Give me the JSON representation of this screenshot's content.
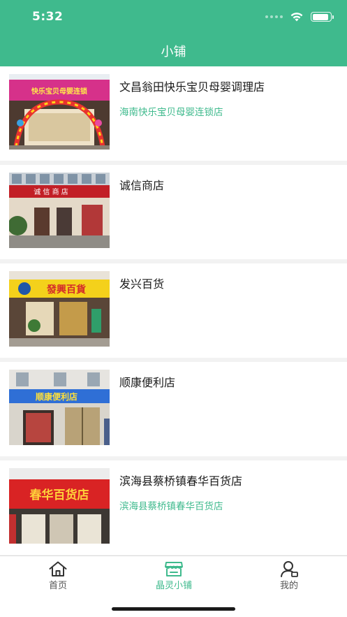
{
  "status_bar": {
    "time": "5:32",
    "battery_level": 0.9
  },
  "header": {
    "title": "小铺"
  },
  "stores": [
    {
      "name": "文昌翁田快乐宝贝母婴调理店",
      "chain": "海南快乐宝贝母婴连锁店",
      "photo_sign": "快乐宝贝母婴连锁"
    },
    {
      "name": "诚信商店",
      "chain": "",
      "photo_sign": "诚 信 商 店"
    },
    {
      "name": "发兴百货",
      "chain": "",
      "photo_sign": "發興百貨"
    },
    {
      "name": "顺康便利店",
      "chain": "",
      "photo_sign": "顺康便利店"
    },
    {
      "name": "滨海县蔡桥镇春华百货店",
      "chain": "滨海县蔡桥镇春华百货店",
      "photo_sign": "春华百货店"
    }
  ],
  "tabbar": {
    "tabs": [
      {
        "label": "首页",
        "icon": "home-icon",
        "active": false
      },
      {
        "label": "晶灵小铺",
        "icon": "shop-icon",
        "active": true
      },
      {
        "label": "我的",
        "icon": "profile-icon",
        "active": false
      }
    ]
  },
  "colors": {
    "accent": "#3fba8d",
    "background": "#f2f2f2",
    "text": "#1a1a1a",
    "tab_inactive": "#555555"
  }
}
